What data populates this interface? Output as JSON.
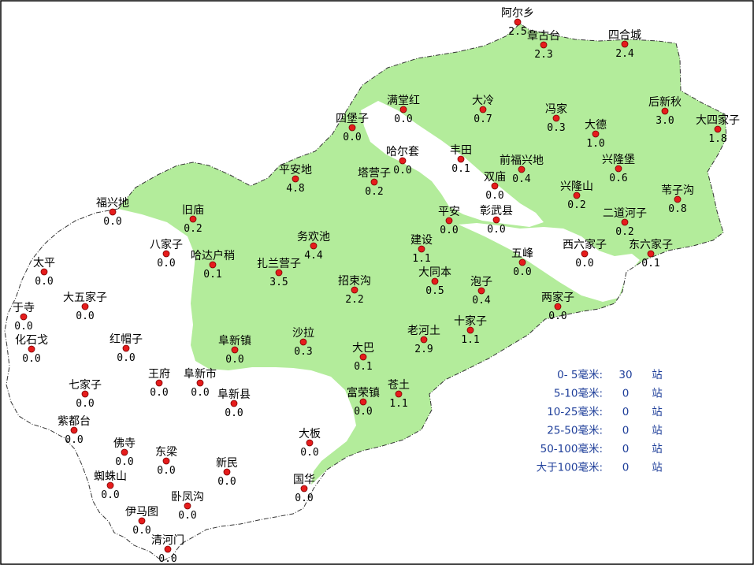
{
  "colors": {
    "rain": "#b3ec9b",
    "dot": "#e61c1c",
    "border": "#000000",
    "legend": "#1f3f9a"
  },
  "stations": [
    {
      "name": "阿尔乡",
      "value": "2.5"
    },
    {
      "name": "章古台",
      "value": "2.3"
    },
    {
      "name": "四合城",
      "value": "2.4"
    },
    {
      "name": "满堂红",
      "value": "0.0"
    },
    {
      "name": "大冷",
      "value": "0.7"
    },
    {
      "name": "冯家",
      "value": "0.3"
    },
    {
      "name": "后新秋",
      "value": "3.0"
    },
    {
      "name": "四堡子",
      "value": "0.0"
    },
    {
      "name": "大德",
      "value": "1.0"
    },
    {
      "name": "大四家子",
      "value": "1.8"
    },
    {
      "name": "哈尔套",
      "value": "0.0"
    },
    {
      "name": "丰田",
      "value": "0.1"
    },
    {
      "name": "前福兴地",
      "value": "0.4"
    },
    {
      "name": "兴隆堡",
      "value": "0.6"
    },
    {
      "name": "平安地",
      "value": "4.8"
    },
    {
      "name": "塔营子",
      "value": "0.2"
    },
    {
      "name": "双庙",
      "value": "0.0"
    },
    {
      "name": "兴隆山",
      "value": "0.2"
    },
    {
      "name": "苇子沟",
      "value": "0.8"
    },
    {
      "name": "福兴地",
      "value": "0.0"
    },
    {
      "name": "旧庙",
      "value": "0.2"
    },
    {
      "name": "平安",
      "value": "0.0"
    },
    {
      "name": "彰武县",
      "value": "0.0"
    },
    {
      "name": "二道河子",
      "value": "0.2"
    },
    {
      "name": "务欢池",
      "value": "4.4"
    },
    {
      "name": "建设",
      "value": "1.1"
    },
    {
      "name": "八家子",
      "value": "0.0"
    },
    {
      "name": "西六家子",
      "value": "0.0"
    },
    {
      "name": "东六家子",
      "value": "0.1"
    },
    {
      "name": "哈达户稍",
      "value": "0.1"
    },
    {
      "name": "扎兰营子",
      "value": "3.5"
    },
    {
      "name": "五峰",
      "value": "0.0"
    },
    {
      "name": "太平",
      "value": "0.0"
    },
    {
      "name": "大同本",
      "value": "0.5"
    },
    {
      "name": "招束沟",
      "value": "2.2"
    },
    {
      "name": "泡子",
      "value": "0.4"
    },
    {
      "name": "大五家子",
      "value": "0.0"
    },
    {
      "name": "两家子",
      "value": "0.0"
    },
    {
      "name": "于寺",
      "value": "0.0"
    },
    {
      "name": "十家子",
      "value": "1.1"
    },
    {
      "name": "沙拉",
      "value": "0.3"
    },
    {
      "name": "老河土",
      "value": "2.9"
    },
    {
      "name": "化石戈",
      "value": "0.0"
    },
    {
      "name": "红帽子",
      "value": "0.0"
    },
    {
      "name": "阜新镇",
      "value": "0.0"
    },
    {
      "name": "大巴",
      "value": "0.1"
    },
    {
      "name": "王府",
      "value": "0.0"
    },
    {
      "name": "阜新市",
      "value": "0.0"
    },
    {
      "name": "七家子",
      "value": "0.0"
    },
    {
      "name": "苍土",
      "value": "1.1"
    },
    {
      "name": "阜新县",
      "value": "0.0"
    },
    {
      "name": "富荣镇",
      "value": "0.0"
    },
    {
      "name": "紫都台",
      "value": "0.0"
    },
    {
      "name": "大板",
      "value": "0.0"
    },
    {
      "name": "佛寺",
      "value": "0.0"
    },
    {
      "name": "东梁",
      "value": "0.0"
    },
    {
      "name": "新民",
      "value": "0.0"
    },
    {
      "name": "蜘蛛山",
      "value": "0.0"
    },
    {
      "name": "国华",
      "value": "0.0"
    },
    {
      "name": "卧凤沟",
      "value": "0.0"
    },
    {
      "name": "伊马图",
      "value": "0.0"
    },
    {
      "name": "清河门",
      "value": "0.0"
    }
  ],
  "legend": [
    {
      "range": "0- 5毫米:",
      "count": "30",
      "unit": "站"
    },
    {
      "range": "5-10毫米:",
      "count": "0",
      "unit": "站"
    },
    {
      "range": "10-25毫米:",
      "count": "0",
      "unit": "站"
    },
    {
      "range": "25-50毫米:",
      "count": "0",
      "unit": "站"
    },
    {
      "range": "50-100毫米:",
      "count": "0",
      "unit": "站"
    },
    {
      "range": "大于100毫米:",
      "count": "0",
      "unit": "站"
    }
  ]
}
